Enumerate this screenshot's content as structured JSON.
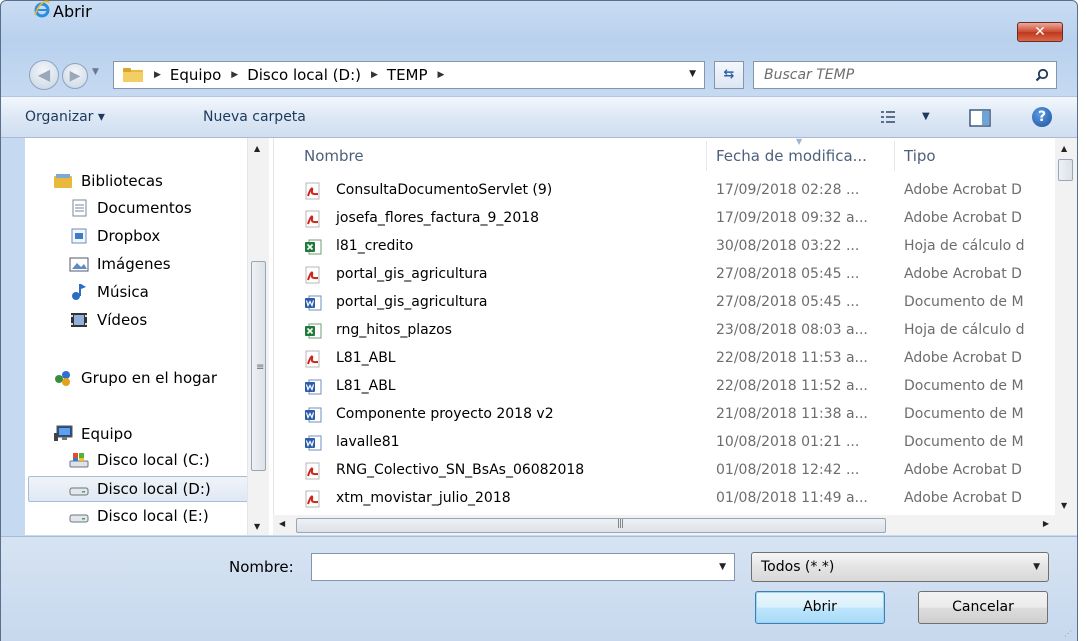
{
  "window": {
    "title": "Abrir",
    "close_label": "✕"
  },
  "address": {
    "breadcrumbs": [
      "Equipo",
      "Disco local (D:)",
      "TEMP"
    ]
  },
  "search": {
    "placeholder": "Buscar TEMP"
  },
  "toolbar": {
    "organize_label": "Organizar ▾",
    "new_folder_label": "Nueva carpeta"
  },
  "navigation": {
    "items": [
      {
        "label": "Bibliotecas",
        "icon": "libraries-icon"
      },
      {
        "label": "Documentos",
        "icon": "documents-icon"
      },
      {
        "label": "Dropbox",
        "icon": "dropbox-icon"
      },
      {
        "label": "Imágenes",
        "icon": "pictures-icon"
      },
      {
        "label": "Música",
        "icon": "music-icon"
      },
      {
        "label": "Vídeos",
        "icon": "videos-icon"
      },
      {
        "label": "Grupo en el hogar",
        "icon": "homegroup-icon"
      },
      {
        "label": "Equipo",
        "icon": "computer-icon"
      },
      {
        "label": "Disco local (C:)",
        "icon": "system-drive-icon"
      },
      {
        "label": "Disco local (D:)",
        "icon": "drive-icon",
        "selected": true
      },
      {
        "label": "Disco local (E:)",
        "icon": "drive-icon"
      }
    ]
  },
  "columns": {
    "name": "Nombre",
    "date": "Fecha de modifica...",
    "type": "Tipo"
  },
  "files": [
    {
      "name": "ConsultaDocumentoServlet (9)",
      "date": "17/09/2018 02:28 ...",
      "type": "Adobe Acrobat D",
      "icon": "pdf-icon"
    },
    {
      "name": "josefa_flores_factura_9_2018",
      "date": "17/09/2018 09:32 a...",
      "type": "Adobe Acrobat D",
      "icon": "pdf-icon"
    },
    {
      "name": "l81_credito",
      "date": "30/08/2018 03:22 ...",
      "type": "Hoja de cálculo d",
      "icon": "excel-icon"
    },
    {
      "name": "portal_gis_agricultura",
      "date": "27/08/2018 05:45 ...",
      "type": "Adobe Acrobat D",
      "icon": "pdf-icon"
    },
    {
      "name": "portal_gis_agricultura",
      "date": "27/08/2018 05:45 ...",
      "type": "Documento de M",
      "icon": "word-icon"
    },
    {
      "name": "rng_hitos_plazos",
      "date": "23/08/2018 08:03 a...",
      "type": "Hoja de cálculo d",
      "icon": "excel-icon"
    },
    {
      "name": "L81_ABL",
      "date": "22/08/2018 11:53 a...",
      "type": "Adobe Acrobat D",
      "icon": "pdf-icon"
    },
    {
      "name": "L81_ABL",
      "date": "22/08/2018 11:52 a...",
      "type": "Documento de M",
      "icon": "word-icon"
    },
    {
      "name": "Componente proyecto 2018 v2",
      "date": "21/08/2018 11:38 a...",
      "type": "Documento de M",
      "icon": "word-icon"
    },
    {
      "name": "lavalle81",
      "date": "10/08/2018 01:21 ...",
      "type": "Documento de M",
      "icon": "word-icon"
    },
    {
      "name": "RNG_Colectivo_SN_BsAs_06082018",
      "date": "01/08/2018 12:42 ...",
      "type": "Adobe Acrobat D",
      "icon": "pdf-icon"
    },
    {
      "name": "xtm_movistar_julio_2018",
      "date": "01/08/2018 11:49 a...",
      "type": "Adobe Acrobat D",
      "icon": "pdf-icon"
    }
  ],
  "footer": {
    "name_label": "Nombre:",
    "name_value": "",
    "filter_value": "Todos (*.*)",
    "open_label": "Abrir",
    "cancel_label": "Cancelar"
  },
  "colors": {
    "pdf": "#d0251b",
    "excel": "#1f7a3a",
    "word": "#2a5caa",
    "folder": "#e8b93c",
    "accent": "#3c7fb1"
  }
}
